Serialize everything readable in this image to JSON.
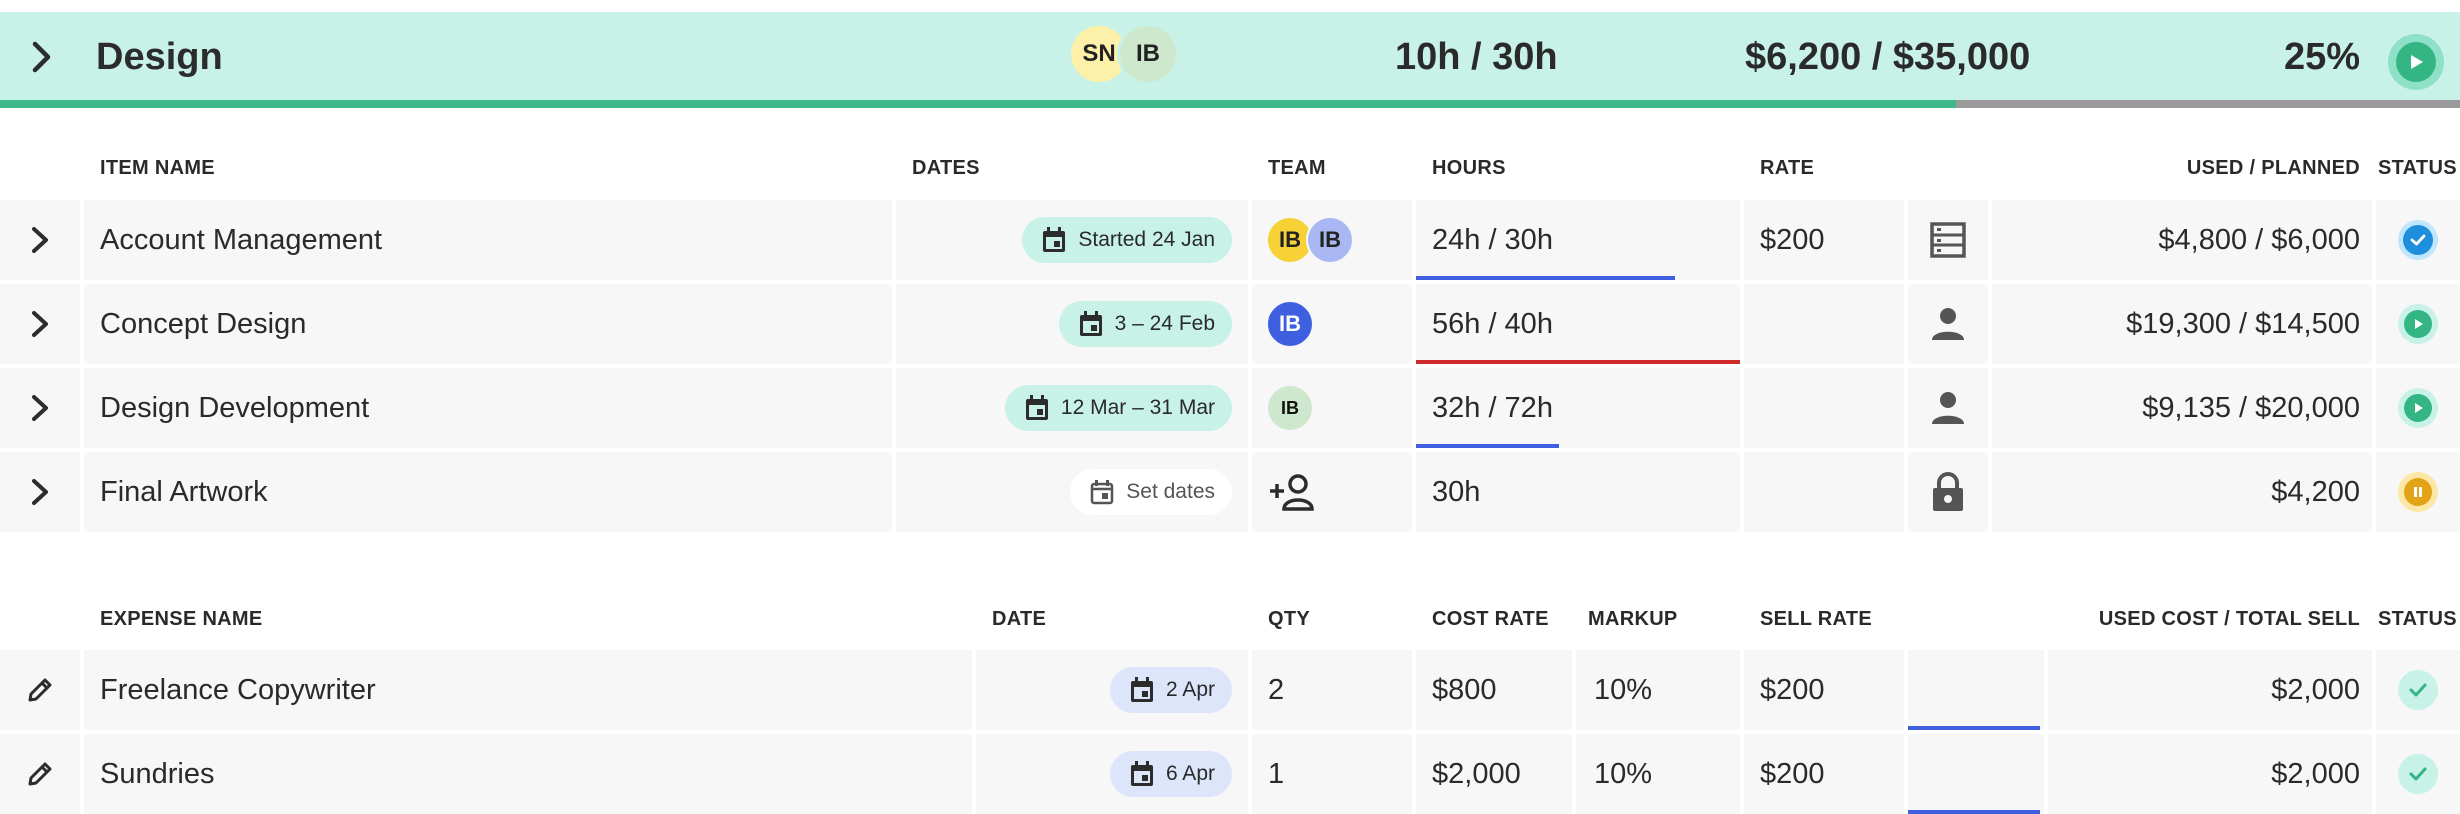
{
  "phase": {
    "title": "Design",
    "avatars": [
      {
        "initials": "SN",
        "color": "#fdf0a8"
      },
      {
        "initials": "IB",
        "color": "#cde8cc"
      }
    ],
    "hours": "10h / 30h",
    "budget": "$6,200 / $35,000",
    "percent": "25%",
    "progress": 0.795,
    "colors": {
      "band": "#c8f2e8",
      "progress": "#3eb78a",
      "track": "#9a9a9a"
    }
  },
  "items_table": {
    "headers": {
      "name": "ITEM NAME",
      "dates": "DATES",
      "team": "TEAM",
      "hours": "HOURS",
      "rate": "RATE",
      "used_planned": "USED / PLANNED",
      "status": "STATUS"
    },
    "rows": [
      {
        "name": "Account Management",
        "dates": "Started 24 Jan",
        "team": [
          "IB",
          "IB"
        ],
        "hours": "24h / 30h",
        "hours_progress": 0.8,
        "rate": "$200",
        "rate_icon": "rate-card-icon",
        "used_planned": "$4,800 / $6,000",
        "status": "complete"
      },
      {
        "name": "Concept Design",
        "dates": "3 – 24 Feb",
        "team": [
          "IB"
        ],
        "hours": "56h / 40h",
        "hours_progress": 1.0,
        "rate": "",
        "rate_icon": "person-icon",
        "used_planned": "$19,300 / $14,500",
        "status": "in-progress"
      },
      {
        "name": "Design Development",
        "dates": "12 Mar – 31 Mar",
        "team": [
          "IB"
        ],
        "hours": "32h / 72h",
        "hours_progress": 0.44,
        "rate": "",
        "rate_icon": "person-icon",
        "used_planned": "$9,135 / $20,000",
        "status": "in-progress"
      },
      {
        "name": "Final Artwork",
        "dates": "Set dates",
        "team": [],
        "hours": "30h",
        "hours_progress": 0,
        "rate": "",
        "rate_icon": "lock-icon",
        "used_planned": "$4,200",
        "status": "paused"
      }
    ]
  },
  "expenses_table": {
    "headers": {
      "name": "EXPENSE NAME",
      "date": "DATE",
      "qty": "QTY",
      "cost_rate": "COST RATE",
      "markup": "MARKUP",
      "sell_rate": "SELL RATE",
      "used_total": "USED COST / TOTAL SELL",
      "status": "STATUS"
    },
    "rows": [
      {
        "name": "Freelance Copywriter",
        "date": "2 Apr",
        "qty": "2",
        "cost_rate": "$800",
        "markup": "10%",
        "sell_rate": "$200",
        "used_total": "$2,000",
        "status": "done"
      },
      {
        "name": "Sundries",
        "date": "6 Apr",
        "qty": "1",
        "cost_rate": "$2,000",
        "markup": "10%",
        "sell_rate": "$200",
        "used_total": "$2,000",
        "status": "done"
      }
    ]
  }
}
